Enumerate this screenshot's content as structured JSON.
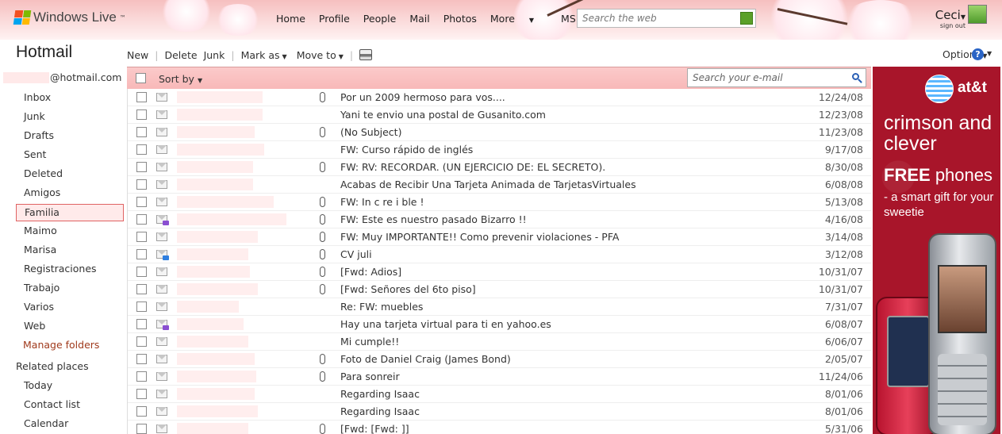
{
  "header": {
    "brand": "Windows Live",
    "nav": [
      {
        "label": "Home"
      },
      {
        "label": "Profile"
      },
      {
        "label": "People"
      },
      {
        "label": "Mail"
      },
      {
        "label": "Photos"
      },
      {
        "label": "More",
        "dropdown": true
      },
      {
        "label": "MSN",
        "dropdown": true
      }
    ],
    "search_placeholder": "Search the web",
    "user": {
      "name": "Ceci",
      "signout": "sign out"
    },
    "colors": {
      "header_pink": "#f6bfbf",
      "search_go": "#5aa028"
    }
  },
  "app": {
    "title": "Hotmail",
    "account_domain": "@hotmail.com"
  },
  "toolbar": {
    "new": "New",
    "delete": "Delete",
    "junk": "Junk",
    "mark_as": "Mark as",
    "move_to": "Move to",
    "print_icon": "printer-icon",
    "options": "Options"
  },
  "folders": [
    "Inbox",
    "Junk",
    "Drafts",
    "Sent",
    "Deleted",
    "Amigos",
    "Familia",
    "Maimo",
    "Marisa",
    "Registraciones",
    "Trabajo",
    "Varios",
    "Web"
  ],
  "selected_folder": "Familia",
  "manage_folders": "Manage folders",
  "related": {
    "title": "Related places",
    "items": [
      "Today",
      "Contact list",
      "Calendar"
    ]
  },
  "list": {
    "sort_label": "Sort by",
    "search_placeholder": "Search your e-mail",
    "messages": [
      {
        "subject": "Por un 2009 hermoso para vos....",
        "date": "12/24/08",
        "attachment": true
      },
      {
        "subject": "Yani te envio una postal de Gusanito.com",
        "date": "12/23/08",
        "attachment": false
      },
      {
        "subject": "(No Subject)",
        "date": "11/23/08",
        "attachment": true
      },
      {
        "subject": "FW: Curso rápido de inglés",
        "date": "9/17/08",
        "attachment": false
      },
      {
        "subject": "FW: RV: RECORDAR. (UN EJERCICIO DE: EL SECRETO).",
        "date": "8/30/08",
        "attachment": true
      },
      {
        "subject": "Acabas de Recibir Una Tarjeta Animada de TarjetasVirtuales",
        "date": "6/08/08",
        "attachment": false
      },
      {
        "subject": "FW: In c re i ble !",
        "date": "5/13/08",
        "attachment": true
      },
      {
        "subject": "FW: Este es nuestro pasado Bizarro !!",
        "date": "4/16/08",
        "attachment": true,
        "icon": "replied"
      },
      {
        "subject": "FW: Muy IMPORTANTE!! Como prevenir violaciones - PFA",
        "date": "3/14/08",
        "attachment": true
      },
      {
        "subject": "CV juli",
        "date": "3/12/08",
        "attachment": true,
        "icon": "forwarded"
      },
      {
        "subject": "[Fwd: Adios]",
        "date": "10/31/07",
        "attachment": true
      },
      {
        "subject": "[Fwd: Señores del 6to piso]",
        "date": "10/31/07",
        "attachment": true
      },
      {
        "subject": "Re: FW: muebles",
        "date": "7/31/07",
        "attachment": false
      },
      {
        "subject": "Hay una tarjeta virtual para ti en yahoo.es",
        "date": "6/08/07",
        "attachment": false,
        "icon": "replied"
      },
      {
        "subject": "Mi cumple!!",
        "date": "6/06/07",
        "attachment": false
      },
      {
        "subject": "Foto de Daniel Craig (James Bond)",
        "date": "2/05/07",
        "attachment": true
      },
      {
        "subject": "Para sonreir",
        "date": "11/24/06",
        "attachment": true
      },
      {
        "subject": "Regarding Isaac",
        "date": "8/01/06",
        "attachment": false
      },
      {
        "subject": "Regarding Isaac",
        "date": "8/01/06",
        "attachment": false
      },
      {
        "subject": "[Fwd: [Fwd: ]]",
        "date": "5/31/06",
        "attachment": true
      }
    ]
  },
  "ad": {
    "brand": "at&t",
    "headline": "crimson and clever",
    "free": "FREE",
    "phones": "phones",
    "tagline": "- a smart gift for your sweetie",
    "background": "#a8152a"
  }
}
